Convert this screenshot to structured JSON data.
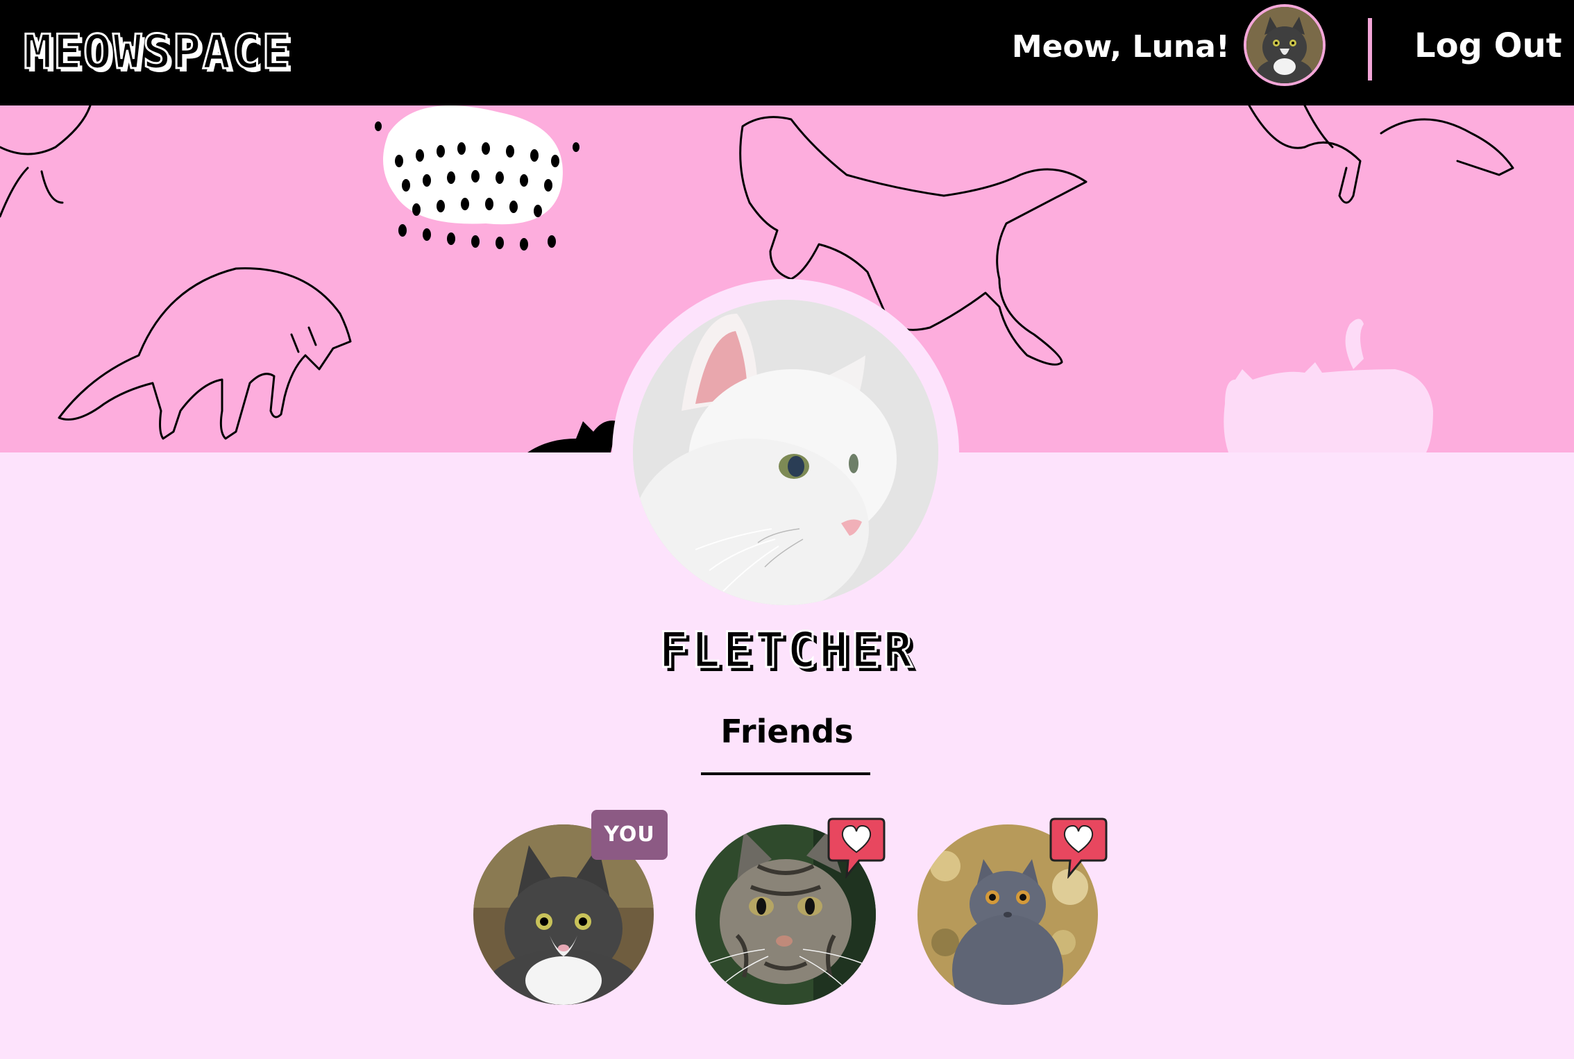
{
  "header": {
    "logo": "MEOWSPACE",
    "greeting": "Meow, Luna!",
    "logout_label": "Log Out",
    "user_avatar_icon": "cat-avatar-icon"
  },
  "profile": {
    "name": "FLETCHER",
    "photo_icon": "white-cat-photo"
  },
  "friends": {
    "heading": "Friends",
    "items": [
      {
        "badge": "YOU",
        "photo": "tuxedo-cat-photo"
      },
      {
        "badge": "heart",
        "photo": "tabby-cat-photo"
      },
      {
        "badge": "heart",
        "photo": "gray-cat-photo"
      }
    ]
  },
  "colors": {
    "header_bg": "#000000",
    "banner_bg": "#fdaddd",
    "page_bg": "#fde3fc",
    "accent_pink": "#f3a6d8",
    "you_badge": "#8c5a84",
    "heart_badge": "#e8475f"
  }
}
